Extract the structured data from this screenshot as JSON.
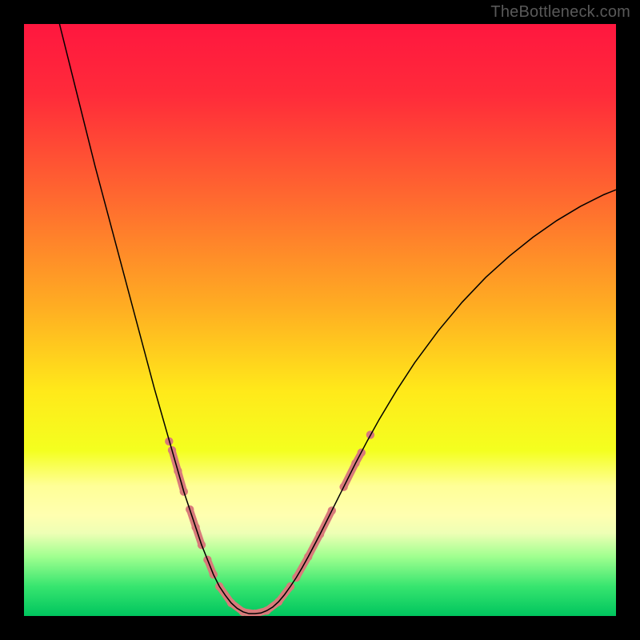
{
  "watermark": "TheBottleneck.com",
  "chart_data": {
    "type": "line",
    "title": "",
    "xlabel": "",
    "ylabel": "",
    "xlim": [
      0,
      100
    ],
    "ylim": [
      0,
      100
    ],
    "background_gradient": {
      "stops": [
        {
          "offset": 0.0,
          "color": "#ff173f"
        },
        {
          "offset": 0.12,
          "color": "#ff2b3a"
        },
        {
          "offset": 0.3,
          "color": "#ff6b2f"
        },
        {
          "offset": 0.48,
          "color": "#ffae22"
        },
        {
          "offset": 0.62,
          "color": "#ffe91a"
        },
        {
          "offset": 0.72,
          "color": "#f4ff1f"
        },
        {
          "offset": 0.78,
          "color": "#ffff97"
        },
        {
          "offset": 0.83,
          "color": "#ffffb0"
        },
        {
          "offset": 0.86,
          "color": "#eeffb5"
        },
        {
          "offset": 0.9,
          "color": "#9fff8f"
        },
        {
          "offset": 0.95,
          "color": "#37e56f"
        },
        {
          "offset": 1.0,
          "color": "#00c55e"
        }
      ]
    },
    "series": [
      {
        "name": "curve",
        "style": {
          "stroke": "#000000",
          "width": 1.5
        },
        "points": [
          {
            "x": 6.0,
            "y": 100.0
          },
          {
            "x": 8.0,
            "y": 92.0
          },
          {
            "x": 10.0,
            "y": 84.0
          },
          {
            "x": 12.0,
            "y": 76.0
          },
          {
            "x": 14.0,
            "y": 68.5
          },
          {
            "x": 16.0,
            "y": 61.0
          },
          {
            "x": 18.0,
            "y": 53.5
          },
          {
            "x": 20.0,
            "y": 46.0
          },
          {
            "x": 22.0,
            "y": 38.5
          },
          {
            "x": 24.0,
            "y": 31.5
          },
          {
            "x": 25.0,
            "y": 28.0
          },
          {
            "x": 26.0,
            "y": 24.5
          },
          {
            "x": 27.0,
            "y": 21.0
          },
          {
            "x": 28.0,
            "y": 18.0
          },
          {
            "x": 29.0,
            "y": 15.0
          },
          {
            "x": 30.0,
            "y": 12.0
          },
          {
            "x": 31.0,
            "y": 9.5
          },
          {
            "x": 32.0,
            "y": 7.0
          },
          {
            "x": 33.0,
            "y": 5.0
          },
          {
            "x": 34.0,
            "y": 3.5
          },
          {
            "x": 35.0,
            "y": 2.2
          },
          {
            "x": 36.0,
            "y": 1.3
          },
          {
            "x": 37.0,
            "y": 0.7
          },
          {
            "x": 38.0,
            "y": 0.4
          },
          {
            "x": 39.0,
            "y": 0.4
          },
          {
            "x": 40.0,
            "y": 0.5
          },
          {
            "x": 41.0,
            "y": 0.9
          },
          {
            "x": 42.0,
            "y": 1.5
          },
          {
            "x": 43.0,
            "y": 2.4
          },
          {
            "x": 44.0,
            "y": 3.6
          },
          {
            "x": 45.0,
            "y": 5.0
          },
          {
            "x": 46.0,
            "y": 6.5
          },
          {
            "x": 47.0,
            "y": 8.2
          },
          {
            "x": 48.0,
            "y": 10.0
          },
          {
            "x": 50.0,
            "y": 13.8
          },
          {
            "x": 52.0,
            "y": 17.8
          },
          {
            "x": 54.0,
            "y": 21.8
          },
          {
            "x": 56.0,
            "y": 25.8
          },
          {
            "x": 58.0,
            "y": 29.6
          },
          {
            "x": 60.0,
            "y": 33.2
          },
          {
            "x": 63.0,
            "y": 38.2
          },
          {
            "x": 66.0,
            "y": 42.8
          },
          {
            "x": 70.0,
            "y": 48.2
          },
          {
            "x": 74.0,
            "y": 53.0
          },
          {
            "x": 78.0,
            "y": 57.2
          },
          {
            "x": 82.0,
            "y": 60.8
          },
          {
            "x": 86.0,
            "y": 64.0
          },
          {
            "x": 90.0,
            "y": 66.8
          },
          {
            "x": 94.0,
            "y": 69.2
          },
          {
            "x": 98.0,
            "y": 71.2
          },
          {
            "x": 100.0,
            "y": 72.0
          }
        ]
      },
      {
        "name": "beads",
        "style": {
          "stroke": "#d87a7a",
          "width": 9,
          "dotRadius": 5.2,
          "fill": "#d87a7a"
        },
        "segments": [
          [
            {
              "x": 25.0,
              "y": 28.0
            },
            {
              "x": 26.0,
              "y": 24.5
            },
            {
              "x": 27.0,
              "y": 21.0
            }
          ],
          [
            {
              "x": 28.0,
              "y": 18.0
            },
            {
              "x": 29.0,
              "y": 15.0
            },
            {
              "x": 30.0,
              "y": 12.0
            }
          ],
          [
            {
              "x": 31.0,
              "y": 9.5
            },
            {
              "x": 32.0,
              "y": 7.0
            }
          ],
          [
            {
              "x": 33.0,
              "y": 5.0
            },
            {
              "x": 35.0,
              "y": 2.2
            },
            {
              "x": 37.0,
              "y": 0.7
            },
            {
              "x": 39.0,
              "y": 0.4
            },
            {
              "x": 41.0,
              "y": 0.9
            },
            {
              "x": 43.0,
              "y": 2.4
            },
            {
              "x": 45.0,
              "y": 5.0
            }
          ],
          [
            {
              "x": 46.0,
              "y": 6.5
            },
            {
              "x": 48.0,
              "y": 10.0
            },
            {
              "x": 50.0,
              "y": 13.8
            },
            {
              "x": 52.0,
              "y": 17.8
            }
          ],
          [
            {
              "x": 54.0,
              "y": 21.8
            },
            {
              "x": 56.0,
              "y": 25.8
            },
            {
              "x": 57.0,
              "y": 27.6
            }
          ]
        ],
        "loose_dots": [
          {
            "x": 24.5,
            "y": 29.5
          },
          {
            "x": 58.5,
            "y": 30.6
          }
        ]
      }
    ]
  }
}
